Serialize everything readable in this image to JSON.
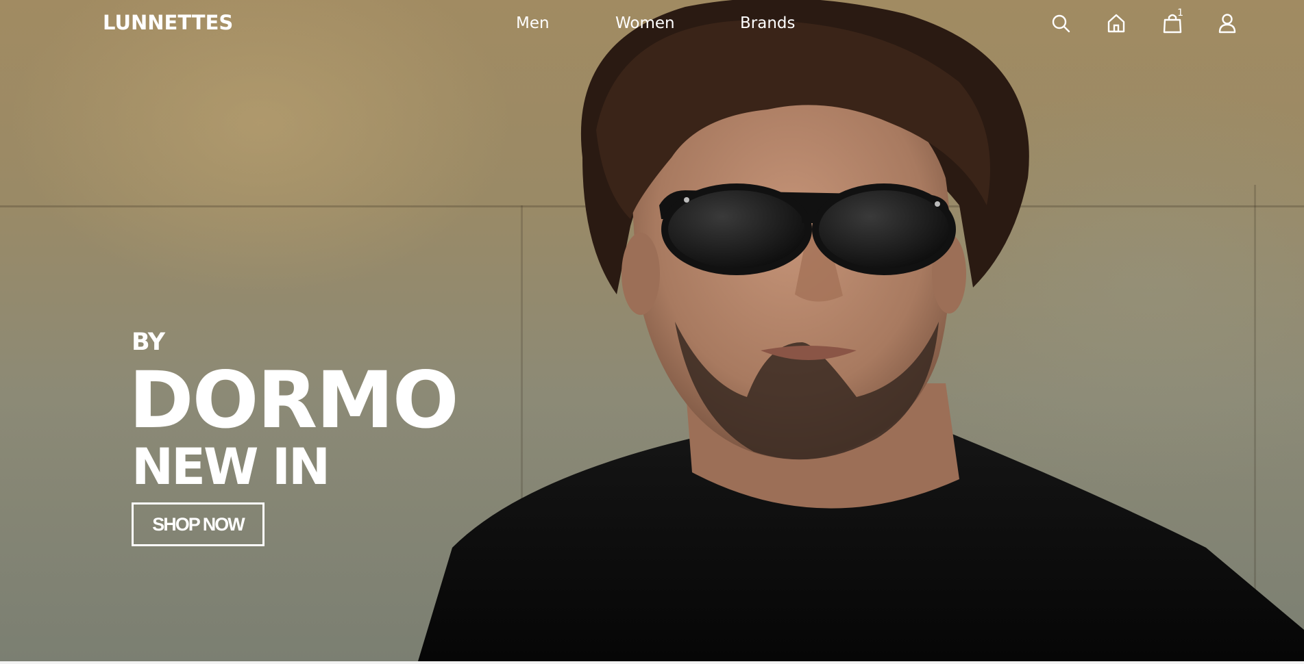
{
  "header": {
    "logo": "LUNNETTES",
    "nav": [
      {
        "label": "Men"
      },
      {
        "label": "Women"
      },
      {
        "label": "Brands"
      }
    ],
    "icons": {
      "search": "search-icon",
      "home": "home-icon",
      "cart": "shopping-bag-icon",
      "account": "user-icon"
    },
    "cart_count": "1"
  },
  "hero": {
    "by": "BY",
    "brand": "DORMO",
    "tagline": "NEW IN",
    "cta": "SHOP NOW"
  },
  "colors": {
    "text": "#ffffff",
    "wall": "#9a8a66",
    "shirt": "#0d0d0d",
    "hair": "#2a1a12",
    "skin": "#b88a6e"
  }
}
